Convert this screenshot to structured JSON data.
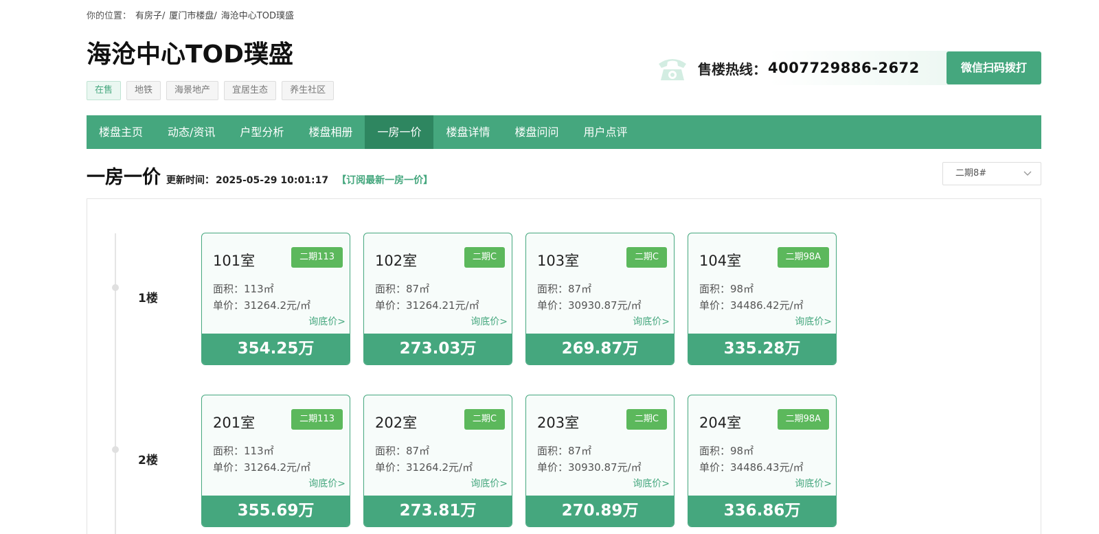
{
  "breadcrumb": {
    "label": "你的位置：",
    "items": [
      "有房子/",
      "厦门市楼盘/",
      "海沧中心TOD璞盛"
    ]
  },
  "project": {
    "title": "海沧中心TOD璞盛",
    "tags": [
      "在售",
      "地铁",
      "海景地产",
      "宜居生态",
      "养生社区"
    ]
  },
  "hotline": {
    "label": "售楼热线：",
    "number": "4007729886-2672",
    "wechat_button": "微信扫码拨打"
  },
  "nav": {
    "items": [
      "楼盘主页",
      "动态/资讯",
      "户型分析",
      "楼盘相册",
      "一房一价",
      "楼盘详情",
      "楼盘问问",
      "用户点评"
    ],
    "active": "一房一价"
  },
  "section": {
    "title": "一房一价",
    "update_label": "更新时间：",
    "update_time": "2025-05-29 10:01:17",
    "subscribe": "【订阅最新一房一价】",
    "building_select": "二期8#"
  },
  "floors": [
    {
      "label": "1楼",
      "units": [
        {
          "room": "101室",
          "badge": "二期113",
          "area": "面积：113㎡",
          "price": "单价：31264.2元/㎡",
          "inquire": "询底价>",
          "total": "354.25万"
        },
        {
          "room": "102室",
          "badge": "二期C",
          "area": "面积：87㎡",
          "price": "单价：31264.21元/㎡",
          "inquire": "询底价>",
          "total": "273.03万"
        },
        {
          "room": "103室",
          "badge": "二期C",
          "area": "面积：87㎡",
          "price": "单价：30930.87元/㎡",
          "inquire": "询底价>",
          "total": "269.87万"
        },
        {
          "room": "104室",
          "badge": "二期98A",
          "area": "面积：98㎡",
          "price": "单价：34486.42元/㎡",
          "inquire": "询底价>",
          "total": "335.28万"
        }
      ]
    },
    {
      "label": "2楼",
      "units": [
        {
          "room": "201室",
          "badge": "二期113",
          "area": "面积：113㎡",
          "price": "单价：31264.2元/㎡",
          "inquire": "询底价>",
          "total": "355.69万"
        },
        {
          "room": "202室",
          "badge": "二期C",
          "area": "面积：87㎡",
          "price": "单价：31264.2元/㎡",
          "inquire": "询底价>",
          "total": "273.81万"
        },
        {
          "room": "203室",
          "badge": "二期C",
          "area": "面积：87㎡",
          "price": "单价：30930.87元/㎡",
          "inquire": "询底价>",
          "total": "270.89万"
        },
        {
          "room": "204室",
          "badge": "二期98A",
          "area": "面积：98㎡",
          "price": "单价：34486.43元/㎡",
          "inquire": "询底价>",
          "total": "336.86万"
        }
      ]
    }
  ],
  "colors": {
    "accent": "#45a77e",
    "accent_dark": "#2e8660",
    "badge": "#5cb85c"
  },
  "icons": {
    "phone": "phone-icon",
    "select": "chevron-down-icon"
  }
}
